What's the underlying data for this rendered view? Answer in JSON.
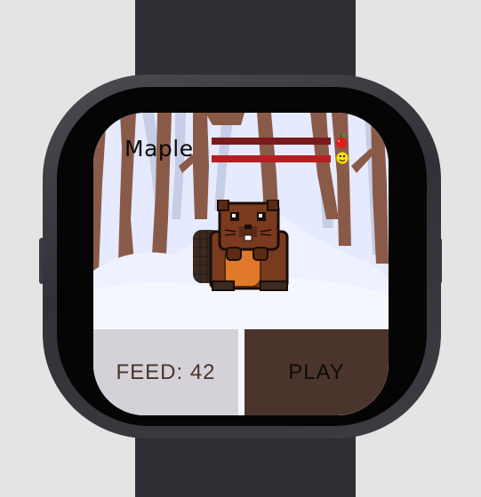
{
  "pet": {
    "name": "Maple"
  },
  "stats": {
    "hunger_level": 1.0,
    "happiness_level": 1.0
  },
  "icons": {
    "hunger": "apple-icon",
    "happiness": "smiley-icon"
  },
  "buttons": {
    "feed_label": "FEED: 42",
    "play_label": "PLAY"
  },
  "colors": {
    "hunger_bar": "#7a1a1c",
    "happiness_bar": "#b51f22",
    "feed_button": "#d4d2d8",
    "play_button": "#4b342c",
    "beaver_fur": "#7a3a1e"
  }
}
